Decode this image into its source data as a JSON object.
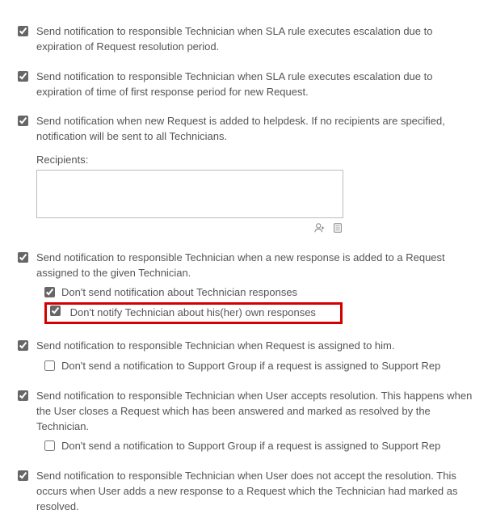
{
  "options": [
    {
      "checked": true,
      "label": "Send notification to responsible Technician when SLA rule executes escalation due to expiration of Request resolution period."
    },
    {
      "checked": true,
      "label": "Send notification to responsible Technician when SLA rule executes escalation due to expiration of time of first response period for new Request."
    },
    {
      "checked": true,
      "label": "Send notification when new Request is added to helpdesk. If no recipients are specified, notification will be sent to all Technicians.",
      "recipients_label": "Recipients:",
      "recipients_value": ""
    },
    {
      "checked": true,
      "label": "Send notification to responsible Technician when a new response is added to a Request assigned to the given Technician.",
      "subs": [
        {
          "checked": true,
          "label": "Don't send notification about Technician responses"
        },
        {
          "checked": true,
          "label": "Don't notify Technician about his(her) own responses",
          "highlight": true
        }
      ]
    },
    {
      "checked": true,
      "label": "Send notification to responsible Technician when Request is assigned to him.",
      "subs": [
        {
          "checked": false,
          "label": "Don't send a notification to Support Group if a request is assigned to Support Rep"
        }
      ]
    },
    {
      "checked": true,
      "label": "Send notification to responsible Technician when User accepts resolution. This happens when the User closes a Request which has been answered and marked as resolved by the Technician.",
      "subs": [
        {
          "checked": false,
          "label": "Don't send a notification to Support Group if a request is assigned to Support Rep"
        }
      ]
    },
    {
      "checked": true,
      "label": "Send notification to responsible Technician when User does not accept the resolution. This occurs when User adds a new response to a Request which the Technician had marked as resolved."
    }
  ]
}
